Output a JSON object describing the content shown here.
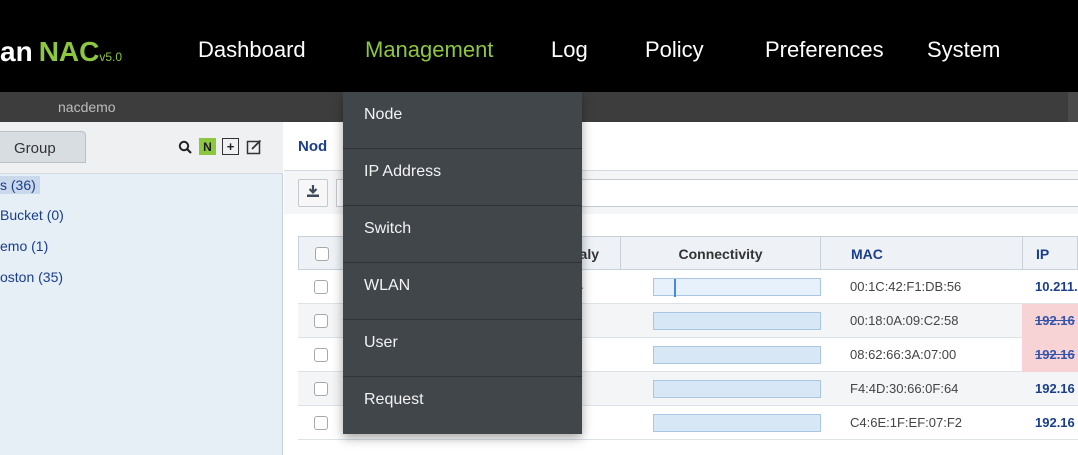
{
  "brand": {
    "name": "an",
    "product": "NAC",
    "version": "v5.0"
  },
  "nav": {
    "items": [
      "Dashboard",
      "Management",
      "Log",
      "Policy",
      "Preferences",
      "System"
    ],
    "active": "Management"
  },
  "subbar": {
    "site": "nacdemo"
  },
  "left_panel": {
    "tab": "Group",
    "icons": [
      "search-icon",
      "n-icon",
      "add-icon",
      "edit-icon"
    ],
    "tree": [
      {
        "label": "s (36)",
        "selected": true
      },
      {
        "label": " Bucket (0)",
        "selected": false
      },
      {
        "label": "emo (1)",
        "selected": false
      },
      {
        "label": "oston (35)",
        "selected": false
      }
    ]
  },
  "main": {
    "title": "Nod",
    "download_icon": "download-icon",
    "table": {
      "headers": [
        "",
        "naly",
        "Connectivity",
        "MAC",
        "IP"
      ],
      "rows": [
        {
          "mac": "00:1C:42:F1:DB:56",
          "ip": "10.211.",
          "ip_status": "normal",
          "extra": "."
        },
        {
          "mac": "00:18:0A:09:C2:58",
          "ip": "192.16",
          "ip_status": "blocked"
        },
        {
          "mac": "08:62:66:3A:07:00",
          "ip": "192.16",
          "ip_status": "blocked"
        },
        {
          "mac": "F4:4D:30:66:0F:64",
          "ip": "192.16",
          "ip_status": "normal"
        },
        {
          "mac": "C4:6E:1F:EF:07:F2",
          "ip": "192.16",
          "ip_status": "normal"
        }
      ]
    }
  },
  "dropdown": {
    "items": [
      "Node",
      "IP Address",
      "Switch",
      "WLAN",
      "User",
      "Request"
    ]
  },
  "colors": {
    "accent_green": "#8dc63f",
    "nav_bg": "#000000",
    "dropdown_bg": "#41464b",
    "link_blue": "#1a3e8c",
    "blocked_bg": "#f7d3d6"
  }
}
